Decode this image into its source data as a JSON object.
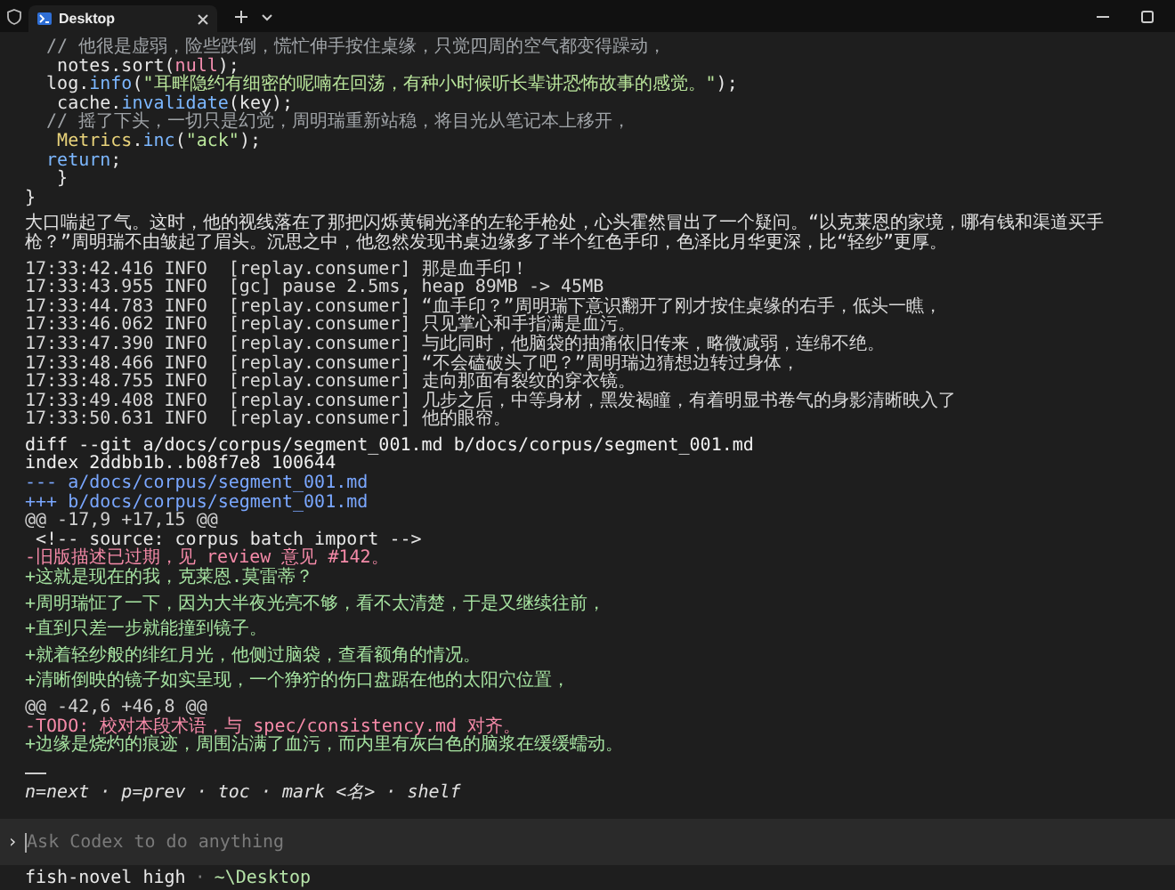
{
  "window": {
    "tabs": [
      {
        "title": "Desktop",
        "selected": true
      }
    ]
  },
  "terminal": {
    "lines": [
      {
        "kind": "code",
        "tokens": [
          {
            "kind": "comment",
            "text": "  // 他很是虚弱，险些跌倒，慌忙伸手按住桌缘，只觉四周的空气都变得躁动，"
          }
        ]
      },
      {
        "kind": "code",
        "tokens": [
          {
            "kind": "plain",
            "text": "   notes.sort("
          },
          {
            "kind": "constant",
            "text": "null"
          },
          {
            "kind": "plain",
            "text": ");"
          }
        ]
      },
      {
        "kind": "code",
        "tokens": [
          {
            "kind": "plain",
            "text": "  log."
          },
          {
            "kind": "function",
            "text": "info"
          },
          {
            "kind": "plain",
            "text": "("
          },
          {
            "kind": "string",
            "text": "\"耳畔隐约有细密的呢喃在回荡，有种小时候听长辈讲恐怖故事的感觉。\""
          },
          {
            "kind": "plain",
            "text": ");"
          }
        ]
      },
      {
        "kind": "code",
        "tokens": [
          {
            "kind": "plain",
            "text": "   cache."
          },
          {
            "kind": "function",
            "text": "invalidate"
          },
          {
            "kind": "plain",
            "text": "(key);"
          }
        ]
      },
      {
        "kind": "code",
        "tokens": [
          {
            "kind": "comment",
            "text": "  // 摇了下头，一切只是幻觉，周明瑞重新站稳，将目光从笔记本上移开，"
          }
        ]
      },
      {
        "kind": "code",
        "tokens": [
          {
            "kind": "class",
            "text": "   Metrics"
          },
          {
            "kind": "plain",
            "text": "."
          },
          {
            "kind": "function",
            "text": "inc"
          },
          {
            "kind": "plain",
            "text": "("
          },
          {
            "kind": "string",
            "text": "\"ack\""
          },
          {
            "kind": "plain",
            "text": ");"
          }
        ]
      },
      {
        "kind": "code",
        "tokens": [
          {
            "kind": "keyword",
            "text": "  return"
          },
          {
            "kind": "plain",
            "text": ";"
          }
        ]
      },
      {
        "kind": "code",
        "tokens": [
          {
            "kind": "plain",
            "text": "   }"
          }
        ]
      },
      {
        "kind": "code",
        "tokens": [
          {
            "kind": "plain",
            "text": "}"
          }
        ]
      },
      {
        "kind": "blank"
      },
      {
        "kind": "prose",
        "text": "大口喘起了气。这时，他的视线落在了那把闪烁黄铜光泽的左轮手枪处，心头霍然冒出了一个疑问。“以克莱恩的家境，哪有钱和渠道买手枪？”周明瑞不由皱起了眉头。沉思之中，他忽然发现书桌边缘多了半个红色手印，色泽比月华更深，比“轻纱”更厚。"
      },
      {
        "kind": "blank"
      },
      {
        "kind": "log",
        "text": "17:33:42.416 INFO  [replay.consumer] 那是血手印！"
      },
      {
        "kind": "log",
        "text": "17:33:43.955 INFO  [gc] pause 2.5ms, heap 89MB -> 45MB"
      },
      {
        "kind": "log",
        "text": "17:33:44.783 INFO  [replay.consumer] “血手印？”周明瑞下意识翻开了刚才按住桌缘的右手，低头一瞧，"
      },
      {
        "kind": "log",
        "text": "17:33:46.062 INFO  [replay.consumer] 只见掌心和手指满是血污。"
      },
      {
        "kind": "log",
        "text": "17:33:47.390 INFO  [replay.consumer] 与此同时，他脑袋的抽痛依旧传来，略微减弱，连绵不绝。"
      },
      {
        "kind": "log",
        "text": "17:33:48.466 INFO  [replay.consumer] “不会磕破头了吧？”周明瑞边猜想边转过身体，"
      },
      {
        "kind": "log",
        "text": "17:33:48.755 INFO  [replay.consumer] 走向那面有裂纹的穿衣镜。"
      },
      {
        "kind": "log",
        "text": "17:33:49.408 INFO  [replay.consumer] 几步之后，中等身材，黑发褐瞳，有着明显书卷气的身影清晰映入了"
      },
      {
        "kind": "log",
        "text": "17:33:50.631 INFO  [replay.consumer] 他的眼帘。"
      },
      {
        "kind": "blank"
      },
      {
        "kind": "diff_header",
        "text": "diff --git a/docs/corpus/segment_001.md b/docs/corpus/segment_001.md"
      },
      {
        "kind": "diff_header",
        "text": "index 2ddbb1b..b08f7e8 100644"
      },
      {
        "kind": "diff_file",
        "text": "--- a/docs/corpus/segment_001.md"
      },
      {
        "kind": "diff_file",
        "text": "+++ b/docs/corpus/segment_001.md"
      },
      {
        "kind": "hunk",
        "text": "@@ -17,9 +17,15 @@"
      },
      {
        "kind": "context",
        "text": " <!-- source: corpus batch import -->"
      },
      {
        "kind": "removed",
        "text": "-旧版描述已过期，见 review 意见 #142。"
      },
      {
        "kind": "added",
        "text": "+这就是现在的我，克莱恩.莫雷蒂？"
      },
      {
        "kind": "blank"
      },
      {
        "kind": "added",
        "text": "+周明瑞怔了一下，因为大半夜光亮不够，看不太清楚，于是又继续往前，"
      },
      {
        "kind": "blank"
      },
      {
        "kind": "added",
        "text": "+直到只差一步就能撞到镜子。"
      },
      {
        "kind": "blank"
      },
      {
        "kind": "added",
        "text": "+就着轻纱般的绯红月光，他侧过脑袋，查看额角的情况。"
      },
      {
        "kind": "blank"
      },
      {
        "kind": "added",
        "text": "+清晰倒映的镜子如实呈现，一个狰狞的伤口盘踞在他的太阳穴位置，"
      },
      {
        "kind": "blank"
      },
      {
        "kind": "hunk",
        "text": "@@ -42,6 +46,8 @@"
      },
      {
        "kind": "removed",
        "text": "-TODO: 校对本段术语，与 spec/consistency.md 对齐。"
      },
      {
        "kind": "added",
        "text": "+边缘是烧灼的痕迹，周围沾满了血污，而内里有灰白色的脑浆在缓缓蠕动。"
      },
      {
        "kind": "blank"
      },
      {
        "kind": "rule"
      },
      {
        "kind": "blank"
      },
      {
        "kind": "hint",
        "text": "n=next · p=prev · toc · mark <名> · shelf"
      }
    ]
  },
  "prompt": {
    "marker": "›",
    "placeholder": "Ask Codex to do anything"
  },
  "status_bar": {
    "profile": "fish-novel high",
    "separator": "·",
    "path": "~\\Desktop"
  }
}
